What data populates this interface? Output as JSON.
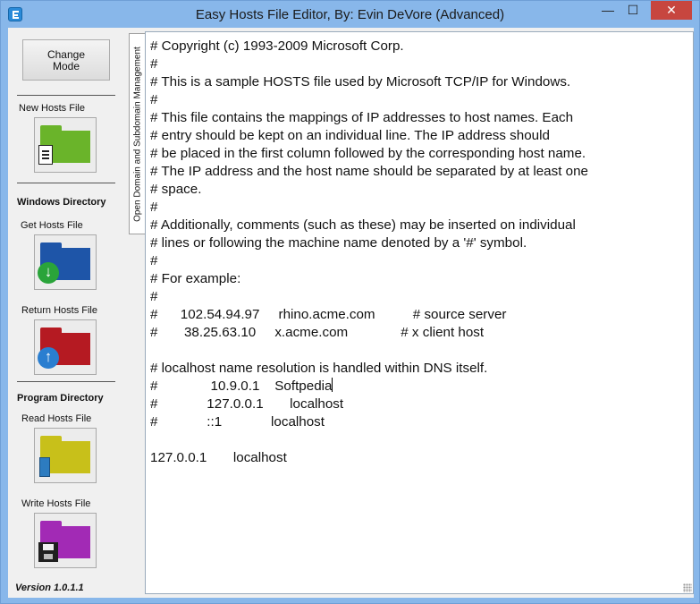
{
  "window": {
    "title": "Easy Hosts File Editor, By: Evin DeVore (Advanced)",
    "minimize_glyph": "—",
    "maximize_glyph": "☐",
    "close_glyph": "✕"
  },
  "sidebar": {
    "change_mode_label": "Change\nMode",
    "new_hosts_file_label": "New Hosts File",
    "windows_directory_heading": "Windows Directory",
    "get_hosts_file_label": "Get Hosts File",
    "return_hosts_file_label": "Return Hosts File",
    "program_directory_heading": "Program Directory",
    "read_hosts_file_label": "Read Hosts File",
    "write_hosts_file_label": "Write Hosts File",
    "version_label": "Version  1.0.1.1",
    "icons": {
      "new": {
        "name": "new-file-folder-icon",
        "color": "#6ab42a"
      },
      "get": {
        "name": "download-folder-icon",
        "color": "#1e55a8"
      },
      "return": {
        "name": "upload-folder-icon",
        "color": "#b51a22"
      },
      "read": {
        "name": "read-folder-icon",
        "color": "#c8c01a"
      },
      "write": {
        "name": "save-folder-icon",
        "color": "#a22ab5"
      }
    }
  },
  "tab": {
    "label": "Open Domain and Subdomain Management"
  },
  "editor": {
    "lines": [
      "# Copyright (c) 1993-2009 Microsoft Corp.",
      "#",
      "# This is a sample HOSTS file used by Microsoft TCP/IP for Windows.",
      "#",
      "# This file contains the mappings of IP addresses to host names. Each",
      "# entry should be kept on an individual line. The IP address should",
      "# be placed in the first column followed by the corresponding host name.",
      "# The IP address and the host name should be separated by at least one",
      "# space.",
      "#",
      "# Additionally, comments (such as these) may be inserted on individual",
      "# lines or following the machine name denoted by a '#' symbol.",
      "#",
      "# For example:",
      "#",
      "#      102.54.94.97     rhino.acme.com          # source server",
      "#       38.25.63.10     x.acme.com              # x client host",
      "",
      "# localhost name resolution is handled within DNS itself.",
      "#              10.9.0.1    Softpedia",
      "#             127.0.0.1       localhost",
      "#             ::1             localhost",
      "",
      "127.0.0.1       localhost"
    ]
  }
}
